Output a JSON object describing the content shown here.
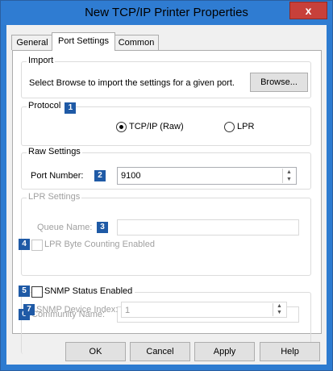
{
  "window": {
    "title": "New TCP/IP Printer Properties",
    "close_glyph": "x"
  },
  "tabs": [
    {
      "label": "General"
    },
    {
      "label": "Port Settings"
    },
    {
      "label": "Common"
    }
  ],
  "import": {
    "legend": "Import",
    "description": "Select Browse to import the settings for a given port.",
    "browse_label": "Browse..."
  },
  "protocol": {
    "legend": "Protocol",
    "badge": "1",
    "options": [
      {
        "label": "TCP/IP (Raw)",
        "selected": true
      },
      {
        "label": "LPR",
        "selected": false
      }
    ]
  },
  "raw_settings": {
    "legend": "Raw Settings",
    "port_label": "Port Number:",
    "badge": "2",
    "port_value": "9100"
  },
  "lpr_settings": {
    "legend": "LPR Settings",
    "queue_label": "Queue Name:",
    "queue_badge": "3",
    "queue_value": "",
    "byte_counting_badge": "4",
    "byte_counting_label": "LPR Byte Counting Enabled",
    "byte_counting_checked": false
  },
  "snmp": {
    "badge": "5",
    "label": "SNMP Status Enabled",
    "checked": false,
    "community_badge": "6",
    "community_label": "Community Name:",
    "community_value": "",
    "device_index_badge": "7",
    "device_index_label": "SNMP Device Index:",
    "device_index_value": "1"
  },
  "buttons": {
    "ok": "OK",
    "cancel": "Cancel",
    "apply": "Apply",
    "help": "Help"
  },
  "colors": {
    "titlebar": "#2f7cd2",
    "close": "#c7403a",
    "badge": "#1f5aa6"
  },
  "icons": {
    "spin_up": "▲",
    "spin_down": "▼"
  }
}
